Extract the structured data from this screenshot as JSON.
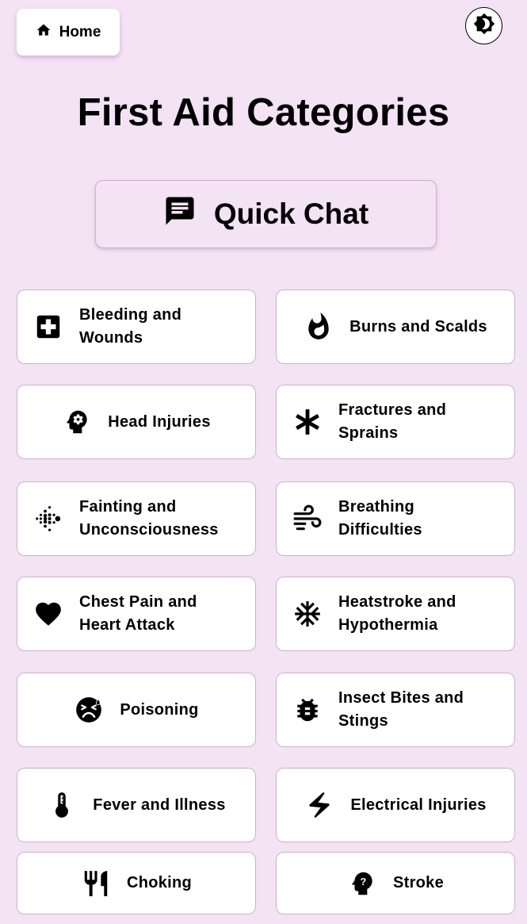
{
  "header": {
    "home_label": "Home",
    "home_icon": "home-icon",
    "theme_icon": "brightness-icon"
  },
  "page": {
    "title": "First Aid Categories"
  },
  "quick_chat": {
    "label": "Quick Chat",
    "icon": "chat-icon"
  },
  "categories": [
    {
      "label": "Bleeding and Wounds",
      "icon": "medical-cross-icon"
    },
    {
      "label": "Burns and Scalds",
      "icon": "fire-icon"
    },
    {
      "label": "Head Injuries",
      "icon": "head-gear-icon"
    },
    {
      "label": "Fractures and Sprains",
      "icon": "asterisk-icon"
    },
    {
      "label": "Fainting and Unconsciousness",
      "icon": "dots-pulse-icon"
    },
    {
      "label": "Breathing Difficulties",
      "icon": "wind-icon"
    },
    {
      "label": "Chest Pain and Heart Attack",
      "icon": "heart-icon"
    },
    {
      "label": "Heatstroke and Hypothermia",
      "icon": "snowflake-icon"
    },
    {
      "label": "Poisoning",
      "icon": "sick-face-icon"
    },
    {
      "label": "Insect Bites and Stings",
      "icon": "bug-icon"
    },
    {
      "label": "Fever and Illness",
      "icon": "thermometer-icon"
    },
    {
      "label": "Electrical Injuries",
      "icon": "lightning-icon"
    },
    {
      "label": "Choking",
      "icon": "fork-knife-icon"
    },
    {
      "label": "Stroke",
      "icon": "head-question-icon"
    }
  ],
  "colors": {
    "background": "#f3e3f5",
    "card": "#ffffff",
    "text": "#000000"
  }
}
